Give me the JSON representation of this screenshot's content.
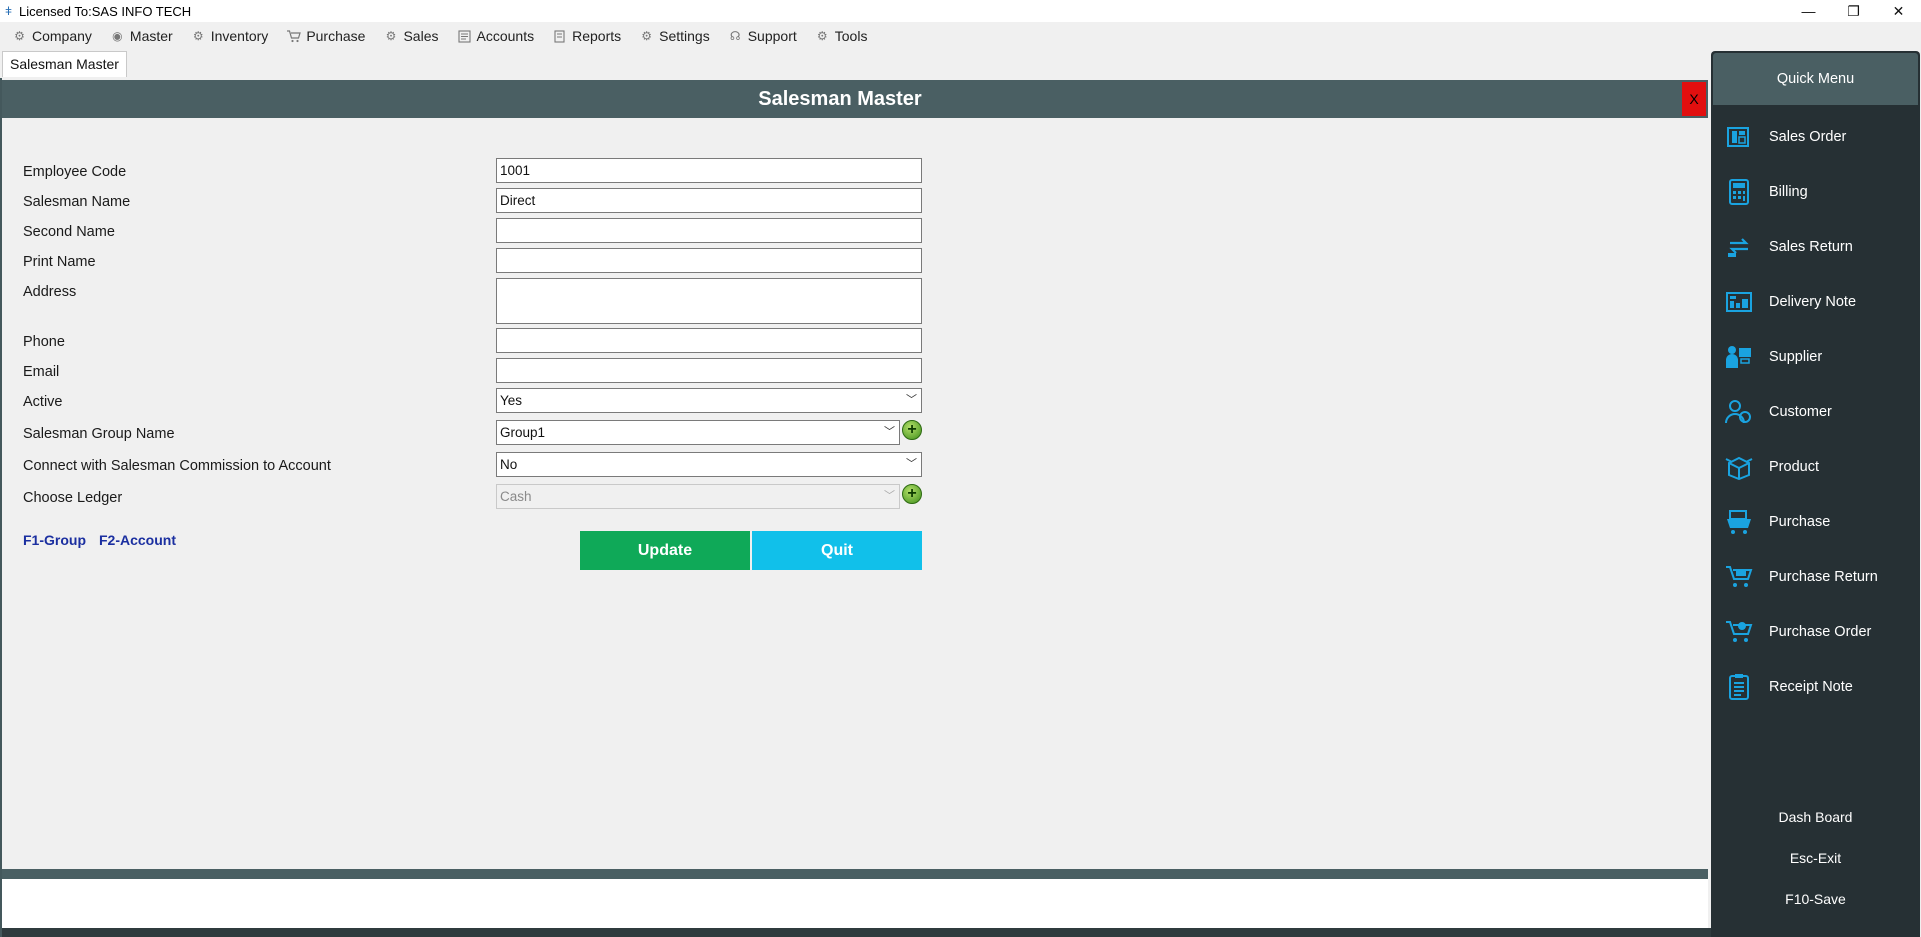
{
  "window": {
    "title": "Licensed To:SAS INFO TECH",
    "minimize_glyph": "—",
    "restore_glyph": "❐",
    "close_glyph": "✕"
  },
  "menu": [
    {
      "label": "Company",
      "icon": "gear-icon"
    },
    {
      "label": "Master",
      "icon": "master-icon"
    },
    {
      "label": "Inventory",
      "icon": "inventory-icon"
    },
    {
      "label": "Purchase",
      "icon": "cart-icon"
    },
    {
      "label": "Sales",
      "icon": "sales-icon"
    },
    {
      "label": "Accounts",
      "icon": "accounts-icon"
    },
    {
      "label": "Reports",
      "icon": "reports-icon"
    },
    {
      "label": "Settings",
      "icon": "gear-icon"
    },
    {
      "label": "Support",
      "icon": "support-icon"
    },
    {
      "label": "Tools",
      "icon": "tools-icon"
    }
  ],
  "tab": {
    "label": "Salesman Master"
  },
  "form": {
    "title": "Salesman Master",
    "close_label": "X",
    "labels": {
      "employee_code": "Employee Code",
      "salesman_name": "Salesman Name",
      "second_name": "Second Name",
      "print_name": "Print Name",
      "address": "Address",
      "phone": "Phone",
      "email": "Email",
      "active": "Active",
      "group_name": "Salesman Group Name",
      "commission": "Connect with Salesman Commission to Account",
      "ledger": "Choose Ledger"
    },
    "values": {
      "employee_code": "1001",
      "salesman_name": "Direct",
      "second_name": "",
      "print_name": "",
      "address": "",
      "phone": "",
      "email": "",
      "active": "Yes",
      "group_name": "Group1",
      "commission": "No",
      "ledger": "Cash"
    },
    "hotkeys": {
      "group": "F1-Group",
      "account": "F2-Account"
    },
    "buttons": {
      "update": "Update",
      "quit": "Quit"
    },
    "add_glyph": "+"
  },
  "quick_menu": {
    "title": "Quick Menu",
    "items": [
      {
        "label": "Sales Order",
        "icon": "sales-order-icon"
      },
      {
        "label": "Billing",
        "icon": "calculator-icon"
      },
      {
        "label": "Sales Return",
        "icon": "sales-return-icon"
      },
      {
        "label": "Delivery Note",
        "icon": "delivery-note-icon"
      },
      {
        "label": "Supplier",
        "icon": "supplier-icon"
      },
      {
        "label": "Customer",
        "icon": "customer-icon"
      },
      {
        "label": "Product",
        "icon": "product-box-icon"
      },
      {
        "label": "Purchase",
        "icon": "purchase-icon"
      },
      {
        "label": "Purchase Return",
        "icon": "purchase-return-icon"
      },
      {
        "label": "Purchase Order",
        "icon": "purchase-order-icon"
      },
      {
        "label": "Receipt Note",
        "icon": "receipt-note-icon"
      }
    ],
    "footer": {
      "dashboard": "Dash Board",
      "exit": "Esc-Exit",
      "save": "F10-Save"
    },
    "icon_color": "#1aa3e0"
  }
}
